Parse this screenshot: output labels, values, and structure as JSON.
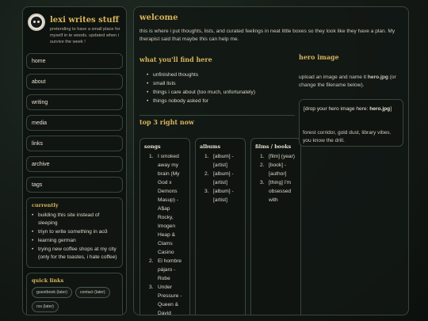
{
  "site": {
    "title": "lexi writes stuff",
    "tagline": "pretending to have a small place for myself in te woods. updated when i survive the week !"
  },
  "nav": [
    "home",
    "about",
    "writing",
    "media",
    "links",
    "archive",
    "tags"
  ],
  "currently": {
    "title": "currently",
    "items": [
      "building this site instead of sleeping",
      "triyn to write something in ao3",
      "learning german",
      "trying new coffee shops at my city (only for the toastes, i hate coffee)"
    ]
  },
  "quick_links": {
    "title": "quick links",
    "items": [
      "guestbook (later)",
      "contact (later)",
      "rss (later)"
    ]
  },
  "welcome": {
    "title": "welcome",
    "intro": "this is where i put thoughts, lists, and curated feelings in neat little boxes so they look like they have a plan. My therapist said that maybe this can help me."
  },
  "find": {
    "title": "what you'll find here",
    "items": [
      "unfinished thoughts",
      "small lists",
      "things i care about (too much, unfortunately)",
      "things nobody asked for"
    ]
  },
  "top3": {
    "title": "top 3 right now",
    "columns": [
      {
        "title": "songs",
        "items": [
          "I smoked away my brain (My God x Demons Masup) - A$ap Rocky, Imogen Heap & Clams Casino",
          "El hombre pájaro - Robe",
          "Under Pressure - Queen & David Bowie"
        ]
      },
      {
        "title": "albums",
        "items": [
          "[album] - [artist]",
          "[album] - [artist]",
          "[album] - [artist]"
        ]
      },
      {
        "title": "films / books",
        "items": [
          "[film] (year)",
          "[book] - [author]",
          "[thing] i'm obsessed with"
        ]
      }
    ]
  },
  "hero": {
    "title": "hero image",
    "desc_prefix": "upload an image and name it ",
    "filename": "hero.jpg",
    "desc_suffix": " (or change the filename below).",
    "drop_prefix": "[drop your hero image here: ",
    "drop_file": "hero.jpg",
    "drop_suffix": "]",
    "caption": "forest corridor, gold dust, library vibes. you know the drill."
  },
  "colors": {
    "accent": "#d7b45a",
    "bg": "#141a16",
    "border": "#39453b"
  }
}
